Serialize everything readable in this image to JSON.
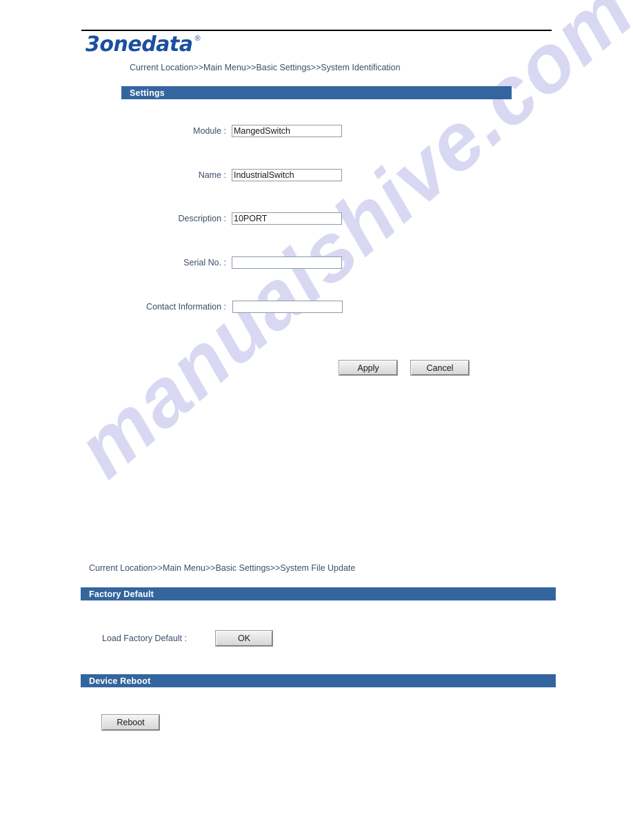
{
  "brand": {
    "name": "3onedata",
    "registered_mark": "®"
  },
  "watermark": {
    "text": "manualshive.com",
    "color": "#b9b9e8"
  },
  "colors": {
    "section_bar": "#34659e",
    "label_text": "#3d4f6b",
    "brand_blue": "#1b4fa0",
    "input_border": "#8a99ab"
  },
  "page_top": {
    "breadcrumb": "Current Location>>Main Menu>>Basic Settings>>System Identification",
    "section_title": "Settings",
    "fields": [
      {
        "label": "Module :",
        "value": "MangedSwitch",
        "placeholder": ""
      },
      {
        "label": "Name :",
        "value": "IndustrialSwitch",
        "placeholder": ""
      },
      {
        "label": "Description :",
        "value": "10PORT",
        "placeholder": ""
      },
      {
        "label": "Serial No. :",
        "value": "",
        "placeholder": ""
      },
      {
        "label": "Contact Information :",
        "value": "",
        "placeholder": ""
      }
    ],
    "buttons": {
      "apply": "Apply",
      "cancel": "Cancel"
    }
  },
  "page_bottom": {
    "breadcrumb": "Current Location>>Main Menu>>Basic Settings>>System File Update",
    "factory_default": {
      "section_title": "Factory Default",
      "label": "Load Factory Default :",
      "button": "OK"
    },
    "device_reboot": {
      "section_title": "Device Reboot",
      "button": "Reboot"
    }
  }
}
